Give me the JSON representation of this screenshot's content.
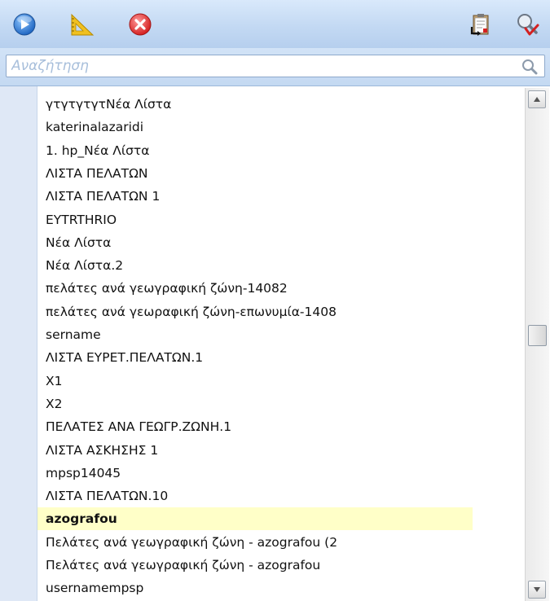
{
  "toolbar": {
    "buttons": [
      {
        "icon": "play-icon"
      },
      {
        "icon": "ruler-triangle-icon"
      },
      {
        "icon": "close-icon"
      },
      {
        "icon": "clipboard-export-icon"
      },
      {
        "icon": "search-clear-icon"
      }
    ]
  },
  "search": {
    "placeholder": "Αναζήτηση",
    "value": "",
    "icon": "magnifier-icon"
  },
  "list": {
    "items": [
      {
        "label": "γτγτγτγτΝέα Λίστα"
      },
      {
        "label": "katerinalazaridi"
      },
      {
        "label": "1. hp_Νέα Λίστα"
      },
      {
        "label": "ΛΙΣΤΑ ΠΕΛΑΤΩΝ"
      },
      {
        "label": "ΛΙΣΤΑ ΠΕΛΑΤΩΝ 1"
      },
      {
        "label": "EYTRTHRIO"
      },
      {
        "label": "Νέα Λίστα"
      },
      {
        "label": "Νέα Λίστα.2"
      },
      {
        "label": "πελάτες ανά γεωγραφική ζώνη-14082"
      },
      {
        "label": "πελάτες ανά γεωραφική ζώνη-επωνυμία-1408"
      },
      {
        "label": "sername"
      },
      {
        "label": "ΛΙΣΤΑ ΕΥΡΕΤ.ΠΕΛΑΤΩΝ.1"
      },
      {
        "label": "X1"
      },
      {
        "label": "X2"
      },
      {
        "label": "ΠΕΛΑΤΕΣ ΑΝΑ ΓΕΩΓΡ.ΖΩΝΗ.1"
      },
      {
        "label": "ΛΙΣΤΑ ΑΣΚΗΣΗΣ 1"
      },
      {
        "label": "mpsp14045"
      },
      {
        "label": "ΛΙΣΤΑ ΠΕΛΑΤΩΝ.10"
      },
      {
        "label": "azografou",
        "selected": true
      },
      {
        "label": "Πελάτες ανά γεωγραφική ζώνη - azografou (2"
      },
      {
        "label": "Πελάτες ανά γεωγραφική ζώνη - azografou"
      },
      {
        "label": "usernamempsp"
      }
    ],
    "selected_index": 18
  },
  "scrollbar": {
    "position": 0.48
  },
  "colors": {
    "toolbar": "#c3d9f3",
    "gutter": "#dfe8f6",
    "selected_row": "#ffffc8"
  }
}
